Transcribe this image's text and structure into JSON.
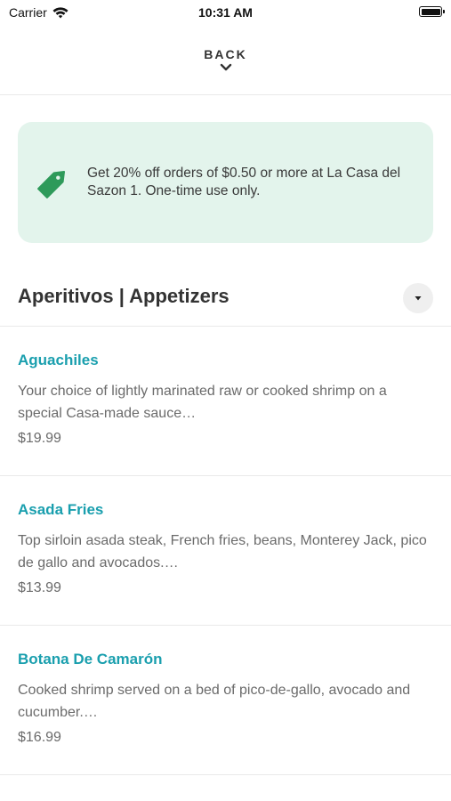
{
  "status_bar": {
    "carrier": "Carrier",
    "time": "10:31 AM"
  },
  "header": {
    "back_label": "BACK"
  },
  "promo": {
    "text": "Get 20% off orders of $0.50 or more at La Casa del Sazon 1. One-time use only.",
    "background_color": "#e3f4ec",
    "icon_color": "#2e9a5a"
  },
  "section": {
    "title": "Aperitivos | Appetizers"
  },
  "menu_items": [
    {
      "name": "Aguachiles",
      "description": "Your choice of lightly marinated raw or cooked shrimp on a special Casa-made sauce…",
      "price": "$19.99"
    },
    {
      "name": "Asada Fries",
      "description": "Top sirloin asada steak, French fries, beans, Monterey Jack, pico de gallo and avocados.…",
      "price": "$13.99"
    },
    {
      "name": "Botana De Camarón",
      "description": "Cooked shrimp served on a bed of pico-de-gallo, avocado and cucumber.…",
      "price": "$16.99"
    }
  ],
  "colors": {
    "accent_teal": "#1a9fae",
    "text_dark": "#333333",
    "text_muted": "#6b6b6b"
  }
}
